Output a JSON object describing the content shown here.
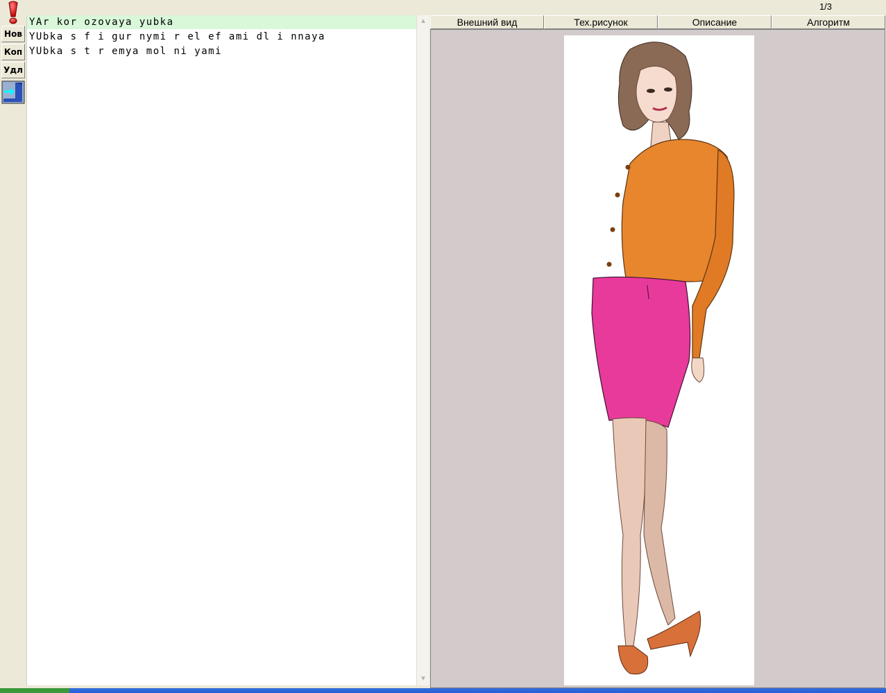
{
  "header": {
    "page_counter": "1/3"
  },
  "toolbar": {
    "run_icon": "exclamation-icon",
    "new_label": "Нов",
    "copy_label": "Коп",
    "delete_label": "Удл",
    "exit_icon": "exit-door-icon"
  },
  "list": {
    "items": [
      {
        "label": "YAr kor ozovaya  yubka",
        "selected": true
      },
      {
        "label": "YUbka  s  f i gur nymi   r el ef ami   dl i nnaya",
        "selected": false
      },
      {
        "label": "YUbka  s  t r emya  mol ni yami",
        "selected": false
      }
    ]
  },
  "tabs": [
    {
      "label": "Внешний вид",
      "active": true
    },
    {
      "label": "Тех.рисунок",
      "active": false
    },
    {
      "label": "Описание",
      "active": false
    },
    {
      "label": "Алгоритм",
      "active": false
    }
  ],
  "colors": {
    "selected_row": "#d9f7d9",
    "viewer_background": "#d3cbcb",
    "jacket": "#e8862e",
    "skirt": "#e83a9a"
  }
}
